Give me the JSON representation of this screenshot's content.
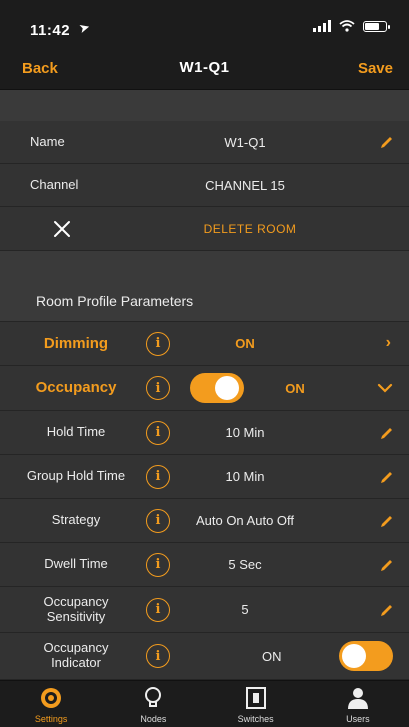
{
  "status_bar": {
    "time": "11:42"
  },
  "nav": {
    "back_label": "Back",
    "title": "W1-Q1",
    "save_label": "Save"
  },
  "room": {
    "name_label": "Name",
    "name_value": "W1-Q1",
    "channel_label": "Channel",
    "channel_value": "CHANNEL 15",
    "delete_label": "DELETE ROOM"
  },
  "profile": {
    "section_title": "Room Profile Parameters",
    "dimming": {
      "label": "Dimming",
      "value": "ON"
    },
    "occupancy": {
      "label": "Occupancy",
      "value": "ON",
      "toggle_on": true
    },
    "params": [
      {
        "label": "Hold Time",
        "value": "10 Min"
      },
      {
        "label": "Group Hold Time",
        "value": "10 Min"
      },
      {
        "label": "Strategy",
        "value": "Auto On Auto Off"
      },
      {
        "label": "Dwell Time",
        "value": "5 Sec"
      },
      {
        "label": "Occupancy Sensitivity",
        "value": "5"
      },
      {
        "label": "Occupancy Indicator",
        "value": "ON",
        "toggle_on": true
      }
    ]
  },
  "tabs": [
    {
      "label": "Settings",
      "icon": "settings-icon",
      "active": true
    },
    {
      "label": "Nodes",
      "icon": "bulb-icon",
      "active": false
    },
    {
      "label": "Switches",
      "icon": "switch-icon",
      "active": false
    },
    {
      "label": "Users",
      "icon": "user-icon",
      "active": false
    }
  ],
  "colors": {
    "accent": "#f39c1e",
    "bar": "#1c1c1c",
    "row": "#333333"
  }
}
